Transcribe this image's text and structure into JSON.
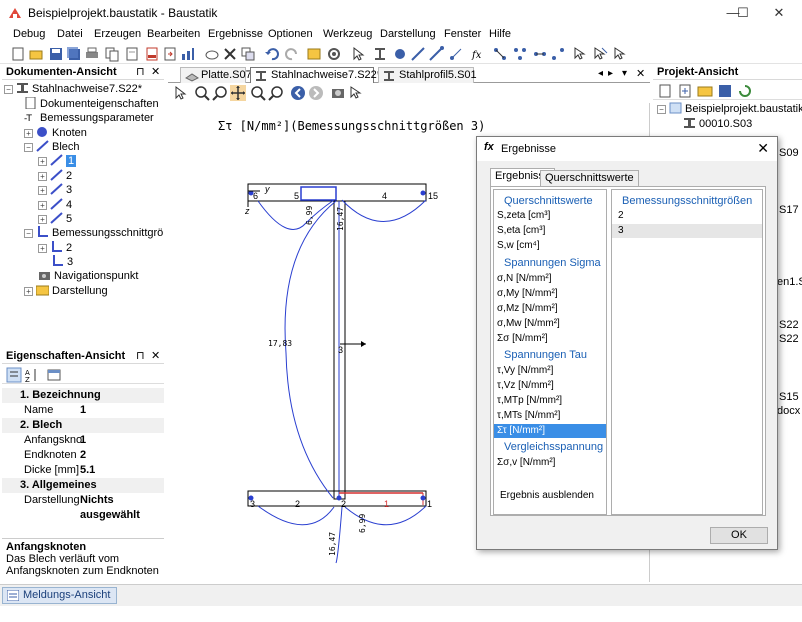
{
  "window": {
    "title": "Beispielprojekt.baustatik - Baustatik",
    "minimize": "—",
    "maximize": "☐",
    "close": "✕"
  },
  "menu": [
    "Debug",
    "Datei",
    "Erzeugen",
    "Bearbeiten",
    "Ergebnisse",
    "Optionen",
    "Werkzeug",
    "Darstellung",
    "Fenster",
    "Hilfe"
  ],
  "doc_panel": {
    "title": "Dokumenten-Ansicht",
    "tree": [
      {
        "label": "Stahlnachweise7.S22*"
      },
      {
        "label": "Dokumenteigenschaften"
      },
      {
        "label": "Bemessungsparameter"
      },
      {
        "label": "Knoten"
      },
      {
        "label": "Blech"
      },
      {
        "label": "1"
      },
      {
        "label": "2"
      },
      {
        "label": "3"
      },
      {
        "label": "4"
      },
      {
        "label": "5"
      },
      {
        "label": "Bemessungsschnittgrößen"
      },
      {
        "label": "2"
      },
      {
        "label": "3"
      },
      {
        "label": "Navigationspunkt"
      },
      {
        "label": "Darstellung"
      }
    ]
  },
  "prop_panel": {
    "title": "Eigenschaften-Ansicht",
    "categories": [
      {
        "label": "1. Bezeichnung"
      },
      {
        "label": "2. Blech"
      },
      {
        "label": "3. Allgemeines"
      }
    ],
    "rows": [
      {
        "key": "Name",
        "value": "1"
      },
      {
        "key": "Anfangskno",
        "value": "1"
      },
      {
        "key": "Endknoten",
        "value": "2"
      },
      {
        "key": "Dicke [mm]",
        "value": "5.1"
      },
      {
        "key": "Darstellung",
        "value": "Nichts ausgewählt"
      }
    ],
    "desc_title": "Anfangsknoten",
    "desc_text1": "Das Blech verläuft vom",
    "desc_text2": "Anfangsknoten zum Endknoten"
  },
  "doc_tabs": [
    "Platte.S07",
    "Stahlnachweise7.S22*",
    "Stahlprofil5.S01"
  ],
  "canvas": {
    "heading": "Στ [N/mm²](Bemessungsschnittgrößen 3)",
    "labels": {
      "top_left_6": "6",
      "top_5": "5",
      "top_4": "4",
      "top_15": "15",
      "top_y": "y",
      "top_z": "z",
      "mid_3": "3",
      "bot_3": "3",
      "bot_2a": "2",
      "bot_2b": "2",
      "bot_1a": "1",
      "bot_1b": "1",
      "val_699_top": "6,99",
      "val_1647_top": "16,47",
      "val_1783": "17,83",
      "val_699_bot": "6,99",
      "val_1647_bot": "16,47"
    }
  },
  "project_panel": {
    "title": "Projekt-Ansicht",
    "root": "Beispielprojekt.baustatik",
    "items": [
      "00010.S03",
      "S09",
      "S17",
      "en1.S",
      "S22",
      "S22",
      "S15",
      "docx"
    ]
  },
  "status": {
    "tab": "Meldungs-Ansicht"
  },
  "dialog": {
    "title": "Ergebnisse",
    "fx": "fx",
    "tabs": [
      "Ergebnisse",
      "Querschnittswerte"
    ],
    "list_left": [
      {
        "label": "Querschnittswerte",
        "group": true
      },
      {
        "label": "S,zeta [cm³]"
      },
      {
        "label": "S,eta [cm³]"
      },
      {
        "label": "S,w [cm⁴]"
      },
      {
        "label": "Spannungen Sigma",
        "group": true
      },
      {
        "label": "σ,N [N/mm²]"
      },
      {
        "label": "σ,My [N/mm²]"
      },
      {
        "label": "σ,Mz [N/mm²]"
      },
      {
        "label": "σ,Mw [N/mm²]"
      },
      {
        "label": "Σσ [N/mm²]"
      },
      {
        "label": "Spannungen Tau",
        "group": true
      },
      {
        "label": "τ,Vy [N/mm²]"
      },
      {
        "label": "τ,Vz [N/mm²]"
      },
      {
        "label": "τ,MTp [N/mm²]"
      },
      {
        "label": "τ,MTs [N/mm²]"
      },
      {
        "label": "Στ [N/mm²]",
        "selected": true
      },
      {
        "label": "Vergleichsspannung",
        "group": true
      },
      {
        "label": "Σσ,v [N/mm²]"
      },
      {
        "label": "Ergebnis ausblenden"
      }
    ],
    "list_right_header": "Bemessungsschnittgrößen",
    "list_right": [
      "2",
      "3"
    ],
    "ok": "OK"
  }
}
